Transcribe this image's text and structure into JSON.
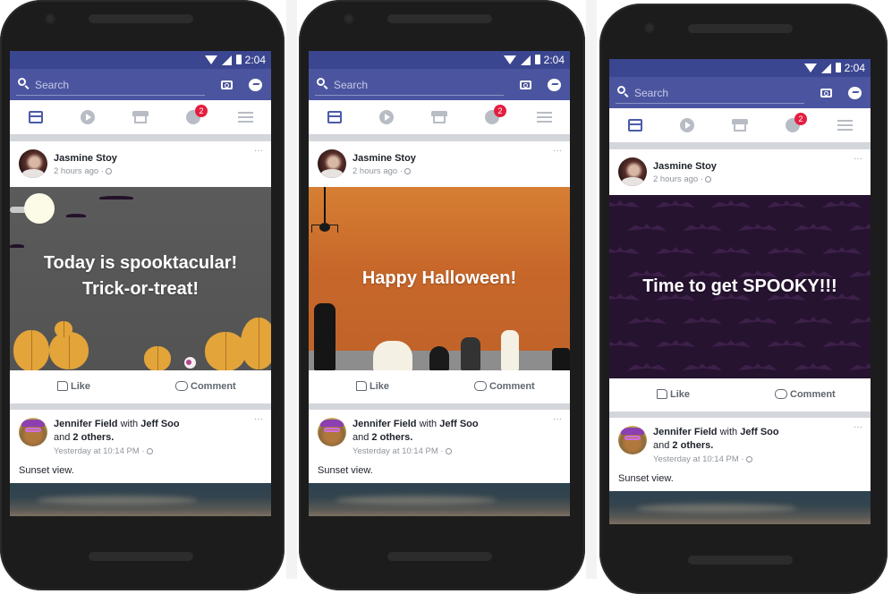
{
  "phones": [
    {
      "status_bar": {
        "time": "2:04"
      },
      "search": {
        "placeholder": "Search"
      },
      "nav": {
        "notifications_badge": "2"
      },
      "post1": {
        "author": "Jasmine Stoy",
        "time": "2 hours ago",
        "caption_line1": "Today is spooktacular!",
        "caption_line2": "Trick-or-treat!",
        "theme": "gray-pumpkins",
        "like_label": "Like",
        "comment_label": "Comment"
      },
      "post2": {
        "author": "Jennifer Field",
        "with_word": "with",
        "tagged": "Jeff Soo",
        "and_word": "and",
        "others": "2 others.",
        "time": "Yesterday at 10:14 PM",
        "text": "Sunset view."
      }
    },
    {
      "status_bar": {
        "time": "2:04"
      },
      "search": {
        "placeholder": "Search"
      },
      "nav": {
        "notifications_badge": "2"
      },
      "post1": {
        "author": "Jasmine Stoy",
        "time": "2 hours ago",
        "caption_line1": "Happy Halloween!",
        "caption_line2": "",
        "theme": "orange-zombies",
        "like_label": "Like",
        "comment_label": "Comment"
      },
      "post2": {
        "author": "Jennifer Field",
        "with_word": "with",
        "tagged": "Jeff Soo",
        "and_word": "and",
        "others": "2 others.",
        "time": "Yesterday at 10:14 PM",
        "text": "Sunset view."
      }
    },
    {
      "status_bar": {
        "time": "2:04"
      },
      "search": {
        "placeholder": "Search"
      },
      "nav": {
        "notifications_badge": "2"
      },
      "post1": {
        "author": "Jasmine Stoy",
        "time": "2 hours ago",
        "caption_line1": "Time to get SPOOKY!!!",
        "caption_line2": "",
        "theme": "purple-bats",
        "like_label": "Like",
        "comment_label": "Comment"
      },
      "post2": {
        "author": "Jennifer Field",
        "with_word": "with",
        "tagged": "Jeff Soo",
        "and_word": "and",
        "others": "2 others.",
        "time": "Yesterday at 10:14 PM",
        "text": "Sunset view."
      }
    }
  ],
  "icons": {
    "more": "···",
    "separator": "·"
  },
  "colors": {
    "brand_header": "#4b559f",
    "status_bar": "#3b4690",
    "badge": "#e41e3f",
    "active_tab": "#4b5ba6"
  }
}
